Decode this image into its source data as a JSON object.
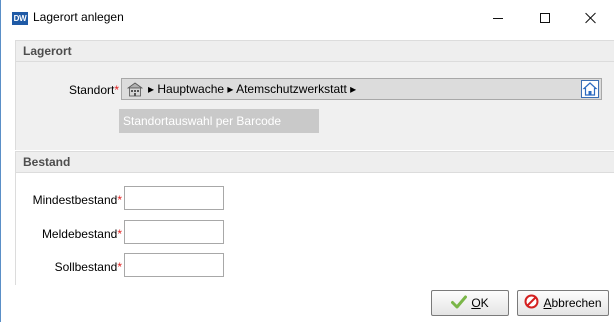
{
  "window": {
    "app_icon_text": "DW",
    "title": "Lagerort anlegen",
    "controls": {
      "minimize": "minimize",
      "maximize": "maximize",
      "close": "close"
    }
  },
  "section_location": {
    "header": "Lagerort",
    "standort_label": "Standort",
    "required_mark": "*",
    "path": "▸ Hauptwache ▸ Atemschutzwerkstatt ▸",
    "barcode_button": "Standortauswahl per Barcode"
  },
  "section_stock": {
    "header": "Bestand",
    "fields": [
      {
        "label": "Mindestbestand",
        "value": ""
      },
      {
        "label": "Meldebestand",
        "value": ""
      },
      {
        "label": "Sollbestand",
        "value": ""
      }
    ]
  },
  "buttons": {
    "ok_first": "O",
    "ok_rest": "K",
    "cancel_first": "A",
    "cancel_rest": "bbrechen"
  },
  "colors": {
    "accent": "#1f5aa6",
    "required": "#e02020",
    "ok_check": "#7ab648",
    "cancel_red": "#d42020"
  }
}
